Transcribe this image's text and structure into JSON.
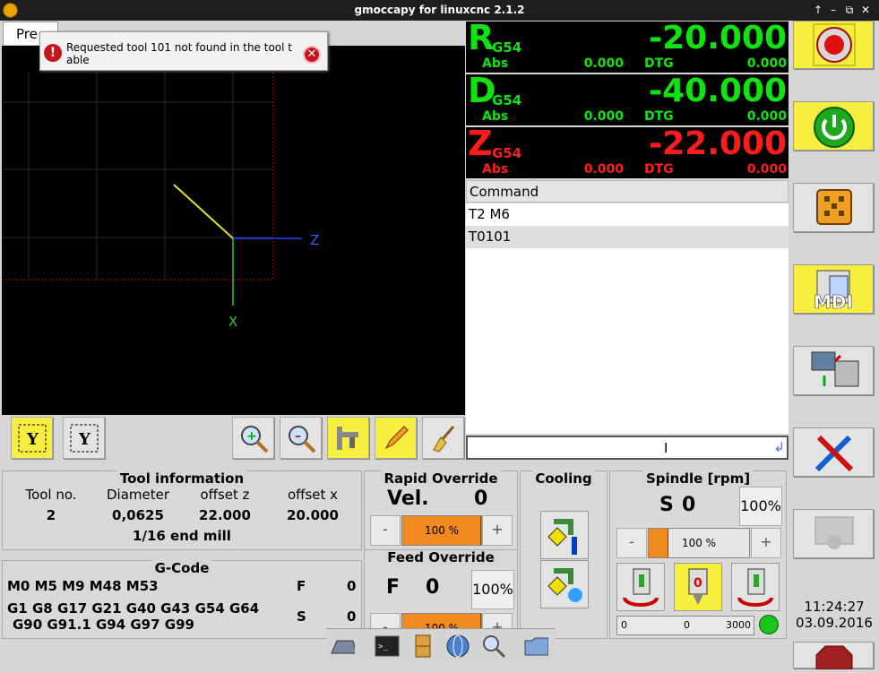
{
  "window": {
    "title": "gmoccapy for linuxcnc  2.1.2"
  },
  "tab": {
    "label": "Pre"
  },
  "notification": {
    "message": "Requested tool 101 not found in the tool table"
  },
  "preview": {
    "axis_z": "Z",
    "axis_x": "X"
  },
  "dro": [
    {
      "axis": "R",
      "offset": "G54",
      "value": "-20.000",
      "abs_label": "Abs",
      "abs_value": "0.000",
      "dtg_label": "DTG",
      "dtg_value": "0.000",
      "color": "#11e311"
    },
    {
      "axis": "D",
      "offset": "G54",
      "value": "-40.000",
      "abs_label": "Abs",
      "abs_value": "0.000",
      "dtg_label": "DTG",
      "dtg_value": "0.000",
      "color": "#11e311"
    },
    {
      "axis": "Z",
      "offset": "G54",
      "value": "-22.000",
      "abs_label": "Abs",
      "abs_value": "0.000",
      "dtg_label": "DTG",
      "dtg_value": "0.000",
      "color": "#ff1c1c"
    }
  ],
  "command": {
    "header": "Command",
    "items": [
      "T2 M6",
      "T0101"
    ],
    "selected_index": 1
  },
  "tool_info": {
    "title": "Tool information",
    "headers": [
      "Tool no.",
      "Diameter",
      "offset z",
      "offset x"
    ],
    "values": [
      "2",
      "0,0625",
      "22.000",
      "20.000"
    ],
    "description": "1/16 end mill"
  },
  "gcode": {
    "title": "G-Code",
    "line1": "M0 M5 M9 M48 M53",
    "line2": "G1 G8 G17 G21 G40 G43 G54 G64",
    "line3": "G90 G91.1 G94 G97 G99",
    "f_label": "F",
    "f_value": "0",
    "s_label": "S",
    "s_value": "0"
  },
  "rapid": {
    "title": "Rapid Override",
    "vel_label": "Vel.",
    "vel_value": "0",
    "minus": "-",
    "plus": "+",
    "slider_label": "100 %",
    "fraction": 1.0
  },
  "feed": {
    "title": "Feed Override",
    "f_label": "F",
    "f_value": "0",
    "percent": "100%",
    "minus": "-",
    "plus": "+",
    "slider_label": "100 %",
    "fraction": 1.0
  },
  "cooling": {
    "title": "Cooling"
  },
  "spindle": {
    "title": "Spindle [rpm]",
    "s_label": "S",
    "s_value": "0",
    "percent": "100%",
    "minus": "-",
    "plus": "+",
    "slider_label": "100 %",
    "bar_min": "0",
    "bar_value": "0",
    "bar_max": "3000",
    "fraction": 0.2
  },
  "clock": {
    "time": "11:24:27",
    "date": "03.09.2016"
  },
  "colors": {
    "accent_yellow": "#f7ee40",
    "override_orange": "#f0891f",
    "dro_green": "#11e311",
    "dro_red": "#ff1c1c",
    "status_green": "#19c619"
  }
}
